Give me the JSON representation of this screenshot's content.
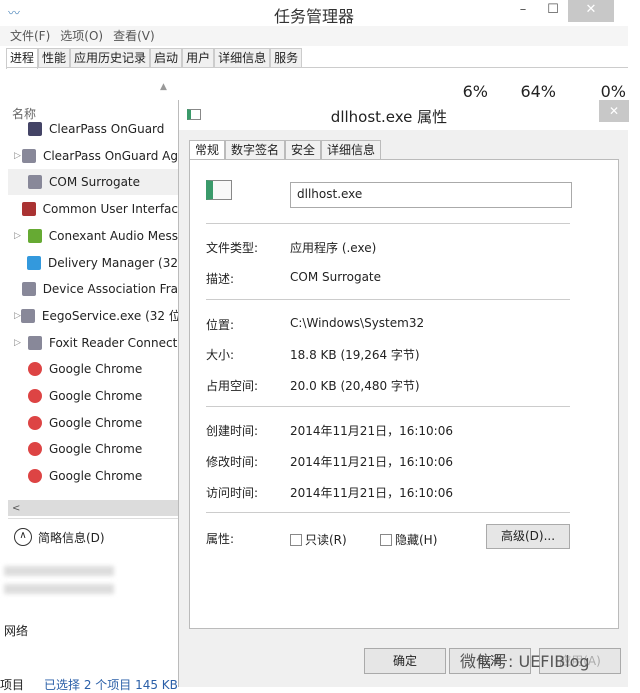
{
  "task_manager": {
    "title": "任务管理器",
    "menu": [
      "文件(F)",
      "选项(O)",
      "查看(V)"
    ],
    "tabs": [
      "进程",
      "性能",
      "应用历史记录",
      "启动",
      "用户",
      "详细信息",
      "服务"
    ],
    "stats": [
      "6%",
      "64%",
      "0%"
    ],
    "column_name": "名称",
    "processes": [
      {
        "name": "ClearPass OnGuard",
        "icon": "app-icon",
        "expandable": false
      },
      {
        "name": "ClearPass OnGuard Ag",
        "icon": "window-icon",
        "expandable": true
      },
      {
        "name": "COM Surrogate",
        "icon": "window-icon",
        "expandable": false,
        "selected": true
      },
      {
        "name": "Common User Interfac",
        "icon": "shield-icon",
        "expandable": false
      },
      {
        "name": "Conexant Audio Mess",
        "icon": "conexant-icon",
        "expandable": true
      },
      {
        "name": "Delivery Manager (32",
        "icon": "delivery-icon",
        "expandable": false
      },
      {
        "name": "Device Association Fra",
        "icon": "window-icon",
        "expandable": false
      },
      {
        "name": "EegoService.exe (32 位",
        "icon": "window-icon",
        "expandable": true
      },
      {
        "name": "Foxit Reader Connect",
        "icon": "window-icon",
        "expandable": true
      },
      {
        "name": "Google Chrome",
        "icon": "chrome-icon",
        "expandable": false
      },
      {
        "name": "Google Chrome",
        "icon": "chrome-icon",
        "expandable": false
      },
      {
        "name": "Google Chrome",
        "icon": "chrome-icon",
        "expandable": false
      },
      {
        "name": "Google Chrome",
        "icon": "chrome-icon",
        "expandable": false
      },
      {
        "name": "Google Chrome",
        "icon": "chrome-icon",
        "expandable": false
      }
    ],
    "brief_label": "简略信息(D)",
    "network_label": "网络",
    "status_items": "项目",
    "status_selected": "已选择 2 个项目  145 KB"
  },
  "dialog": {
    "title": "dllhost.exe 属性",
    "tabs": [
      "常规",
      "数字签名",
      "安全",
      "详细信息"
    ],
    "filename": "dllhost.exe",
    "fields": {
      "type_label": "文件类型:",
      "type": "应用程序 (.exe)",
      "desc_label": "描述:",
      "desc": "COM Surrogate",
      "location_label": "位置:",
      "location": "C:\\Windows\\System32",
      "size_label": "大小:",
      "size": "18.8 KB (19,264 字节)",
      "disk_label": "占用空间:",
      "disk": "20.0 KB (20,480 字节)",
      "created_label": "创建时间:",
      "created": "2014年11月21日，16:10:06",
      "modified_label": "修改时间:",
      "modified": "2014年11月21日，16:10:06",
      "accessed_label": "访问时间:",
      "accessed": "2014年11月21日，16:10:06",
      "attr_label": "属性:"
    },
    "readonly_label": "只读(R)",
    "readonly": false,
    "hidden_label": "隐藏(H)",
    "hidden": false,
    "advanced_label": "高级(D)...",
    "ok_label": "确定",
    "cancel_label": "取消",
    "apply_label": "应用(A)"
  },
  "watermark": "微信号: UEFIBlog"
}
